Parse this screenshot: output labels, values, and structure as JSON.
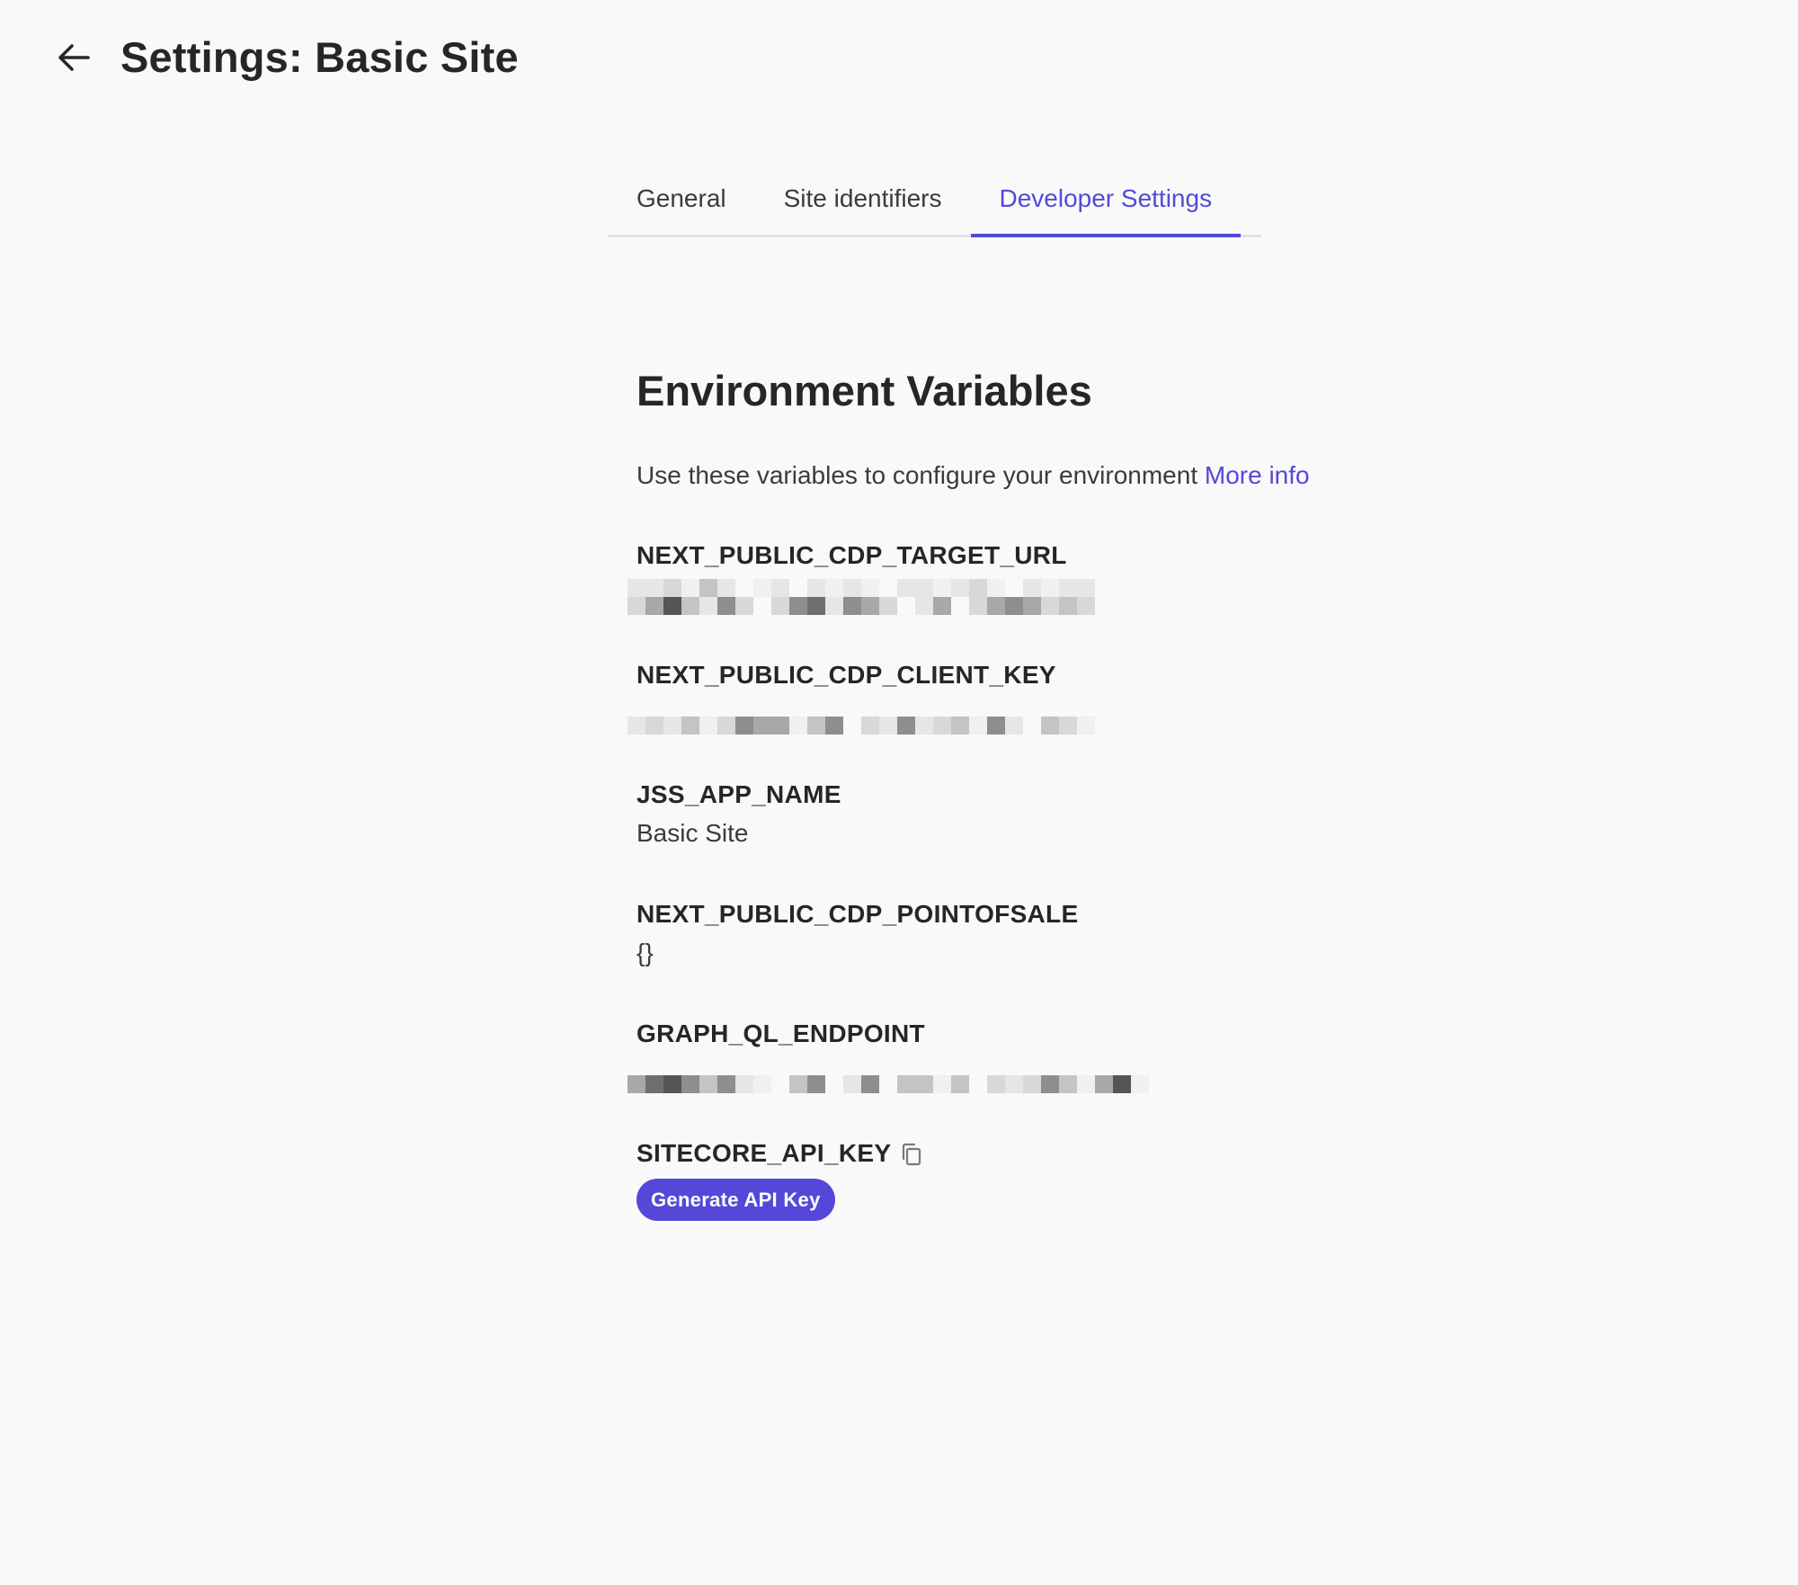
{
  "header": {
    "back_icon": "arrow-left-icon",
    "title": "Settings: Basic Site"
  },
  "tabs": [
    {
      "label": "General",
      "active": false
    },
    {
      "label": "Site identifiers",
      "active": false
    },
    {
      "label": "Developer Settings",
      "active": true
    }
  ],
  "section": {
    "title": "Environment Variables",
    "intro_text": "Use these variables to configure your environment ",
    "more_info_link": "More info"
  },
  "variables": [
    {
      "name": "NEXT_PUBLIC_CDP_TARGET_URL",
      "value": null,
      "redacted": true
    },
    {
      "name": "NEXT_PUBLIC_CDP_CLIENT_KEY",
      "value": null,
      "redacted": true
    },
    {
      "name": "JSS_APP_NAME",
      "value": "Basic Site",
      "redacted": false
    },
    {
      "name": "NEXT_PUBLIC_CDP_POINTOFSALE",
      "value": "{}",
      "redacted": false
    },
    {
      "name": "GRAPH_QL_ENDPOINT",
      "value": null,
      "redacted": true
    },
    {
      "name": "SITECORE_API_KEY",
      "copy_icon": "copy-icon",
      "button_label": "Generate API Key"
    }
  ],
  "colors": {
    "accent": "#5548d9",
    "background": "#f9f9fa",
    "text": "#262626"
  }
}
